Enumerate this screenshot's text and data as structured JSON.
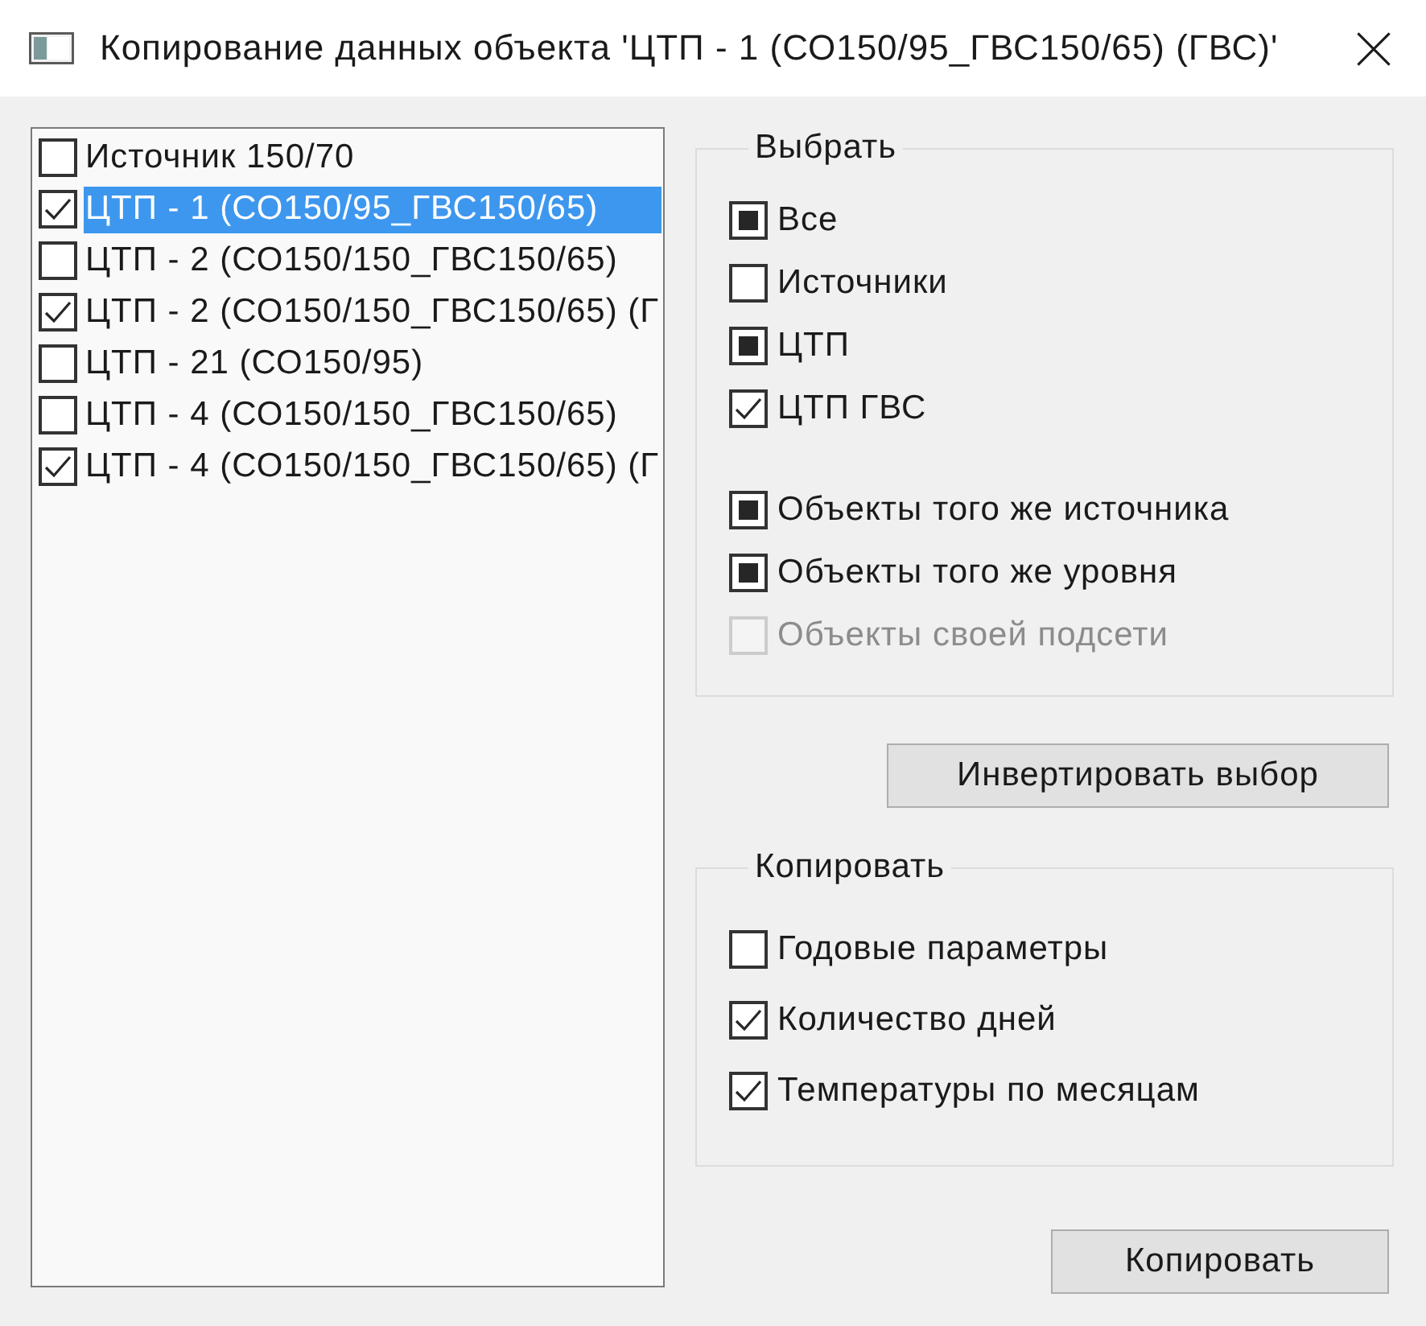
{
  "window": {
    "title": "Копирование данных объекта 'ЦТП - 1 (СО150/95_ГВС150/65) (ГВС)'"
  },
  "objects": [
    {
      "label": "Источник 150/70",
      "checked": false,
      "selected": false
    },
    {
      "label": "ЦТП - 1 (СО150/95_ГВС150/65)",
      "checked": true,
      "selected": true
    },
    {
      "label": "ЦТП - 2 (СО150/150_ГВС150/65)",
      "checked": false,
      "selected": false
    },
    {
      "label": "ЦТП - 2 (СО150/150_ГВС150/65) (Г",
      "checked": true,
      "selected": false
    },
    {
      "label": "ЦТП - 21 (СО150/95)",
      "checked": false,
      "selected": false
    },
    {
      "label": "ЦТП - 4 (СО150/150_ГВС150/65)",
      "checked": false,
      "selected": false
    },
    {
      "label": "ЦТП - 4 (СО150/150_ГВС150/65) (Г",
      "checked": true,
      "selected": false
    }
  ],
  "select_group": {
    "title": "Выбрать",
    "type_filters": [
      {
        "label": "Все",
        "checked": false,
        "mixed": true
      },
      {
        "label": "Источники",
        "checked": false,
        "mixed": false
      },
      {
        "label": "ЦТП",
        "checked": false,
        "mixed": true
      },
      {
        "label": "ЦТП ГВС",
        "checked": true,
        "mixed": false
      }
    ],
    "relation_filters": [
      {
        "label": "Объекты того же источника",
        "checked": false,
        "mixed": true,
        "disabled": false
      },
      {
        "label": "Объекты того же уровня",
        "checked": false,
        "mixed": true,
        "disabled": false
      },
      {
        "label": "Объекты своей подсети",
        "checked": false,
        "mixed": false,
        "disabled": true
      }
    ]
  },
  "invert_button": "Инвертировать выбор",
  "copy_group": {
    "title": "Копировать",
    "options": [
      {
        "label": "Годовые параметры",
        "checked": false
      },
      {
        "label": "Количество дней",
        "checked": true
      },
      {
        "label": "Температуры по месяцам",
        "checked": true
      }
    ]
  },
  "copy_button": "Копировать"
}
